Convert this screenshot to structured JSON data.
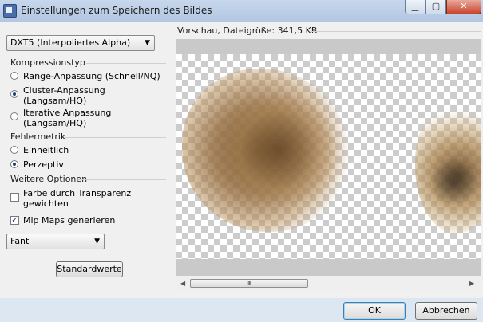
{
  "window": {
    "title": "Einstellungen zum Speichern des Bildes",
    "icon": "image-icon"
  },
  "left": {
    "format_select": "DXT5 (Interpoliertes Alpha)",
    "compression": {
      "label": "Kompressionstyp",
      "options": [
        "Range-Anpassung (Schnell/NQ)",
        "Cluster-Anpassung (Langsam/HQ)",
        "Iterative Anpassung (Langsam/HQ)"
      ],
      "selected": 1
    },
    "error_metric": {
      "label": "Fehlermetrik",
      "options": [
        "Einheitlich",
        "Perzeptiv"
      ],
      "selected": 1
    },
    "more": {
      "label": "Weitere Optionen",
      "transparency": "Farbe durch Transparenz gewichten",
      "transparency_checked": false,
      "mipmaps": "Mip Maps generieren",
      "mipmaps_checked": true
    },
    "filter_select": "Fant",
    "defaults_button": "Standardwerte"
  },
  "preview": {
    "label": "Vorschau, Dateigröße: 341,5 KB",
    "scroll_grip": "III"
  },
  "footer": {
    "ok": "OK",
    "cancel": "Abbrechen"
  }
}
